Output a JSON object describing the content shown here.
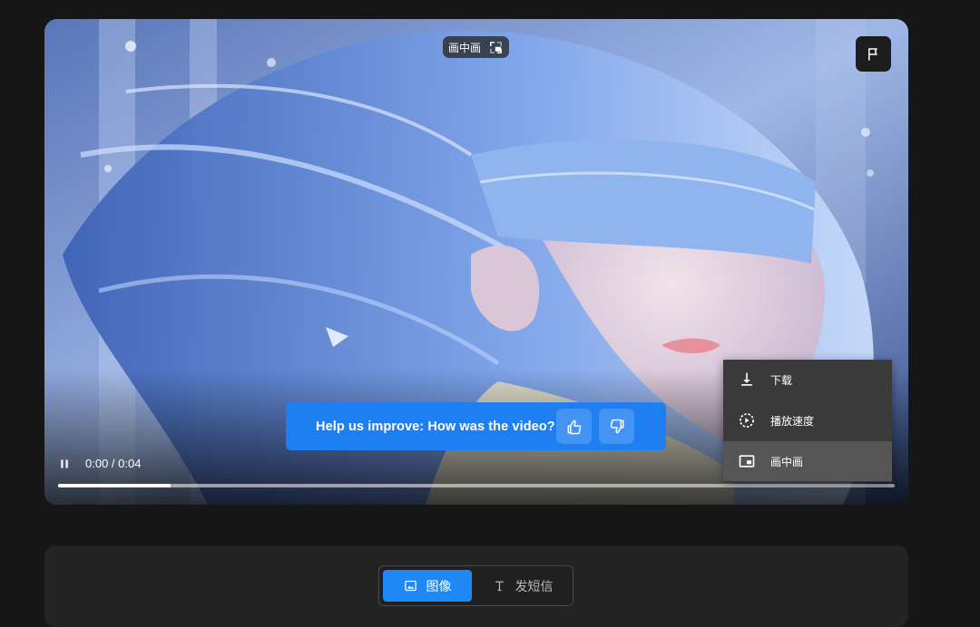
{
  "player": {
    "pip_chip": {
      "label": "画中画",
      "icon": "pip-exit-icon"
    },
    "flag": {
      "icon": "flag-icon"
    },
    "feedback": {
      "prompt": "Help us improve: How was the video?",
      "like_icon": "thumbs-up-icon",
      "dislike_icon": "thumbs-down-icon",
      "color": "#1f7ff0"
    },
    "controls": {
      "play_state_icon": "pause-icon",
      "time": "0:00 / 0:04",
      "progress": 0.134
    },
    "menu": {
      "items": [
        {
          "label": "下载",
          "icon": "download-icon"
        },
        {
          "label": "播放速度",
          "icon": "playback-speed-icon"
        },
        {
          "label": "画中画",
          "icon": "picture-in-picture-icon",
          "active": true
        }
      ]
    }
  },
  "bottom_panel": {
    "tabs": [
      {
        "label": "图像",
        "icon": "image-icon",
        "active": true
      },
      {
        "label": "发短信",
        "icon": "text-icon",
        "active": false
      }
    ],
    "accent": "#1e88f5"
  }
}
